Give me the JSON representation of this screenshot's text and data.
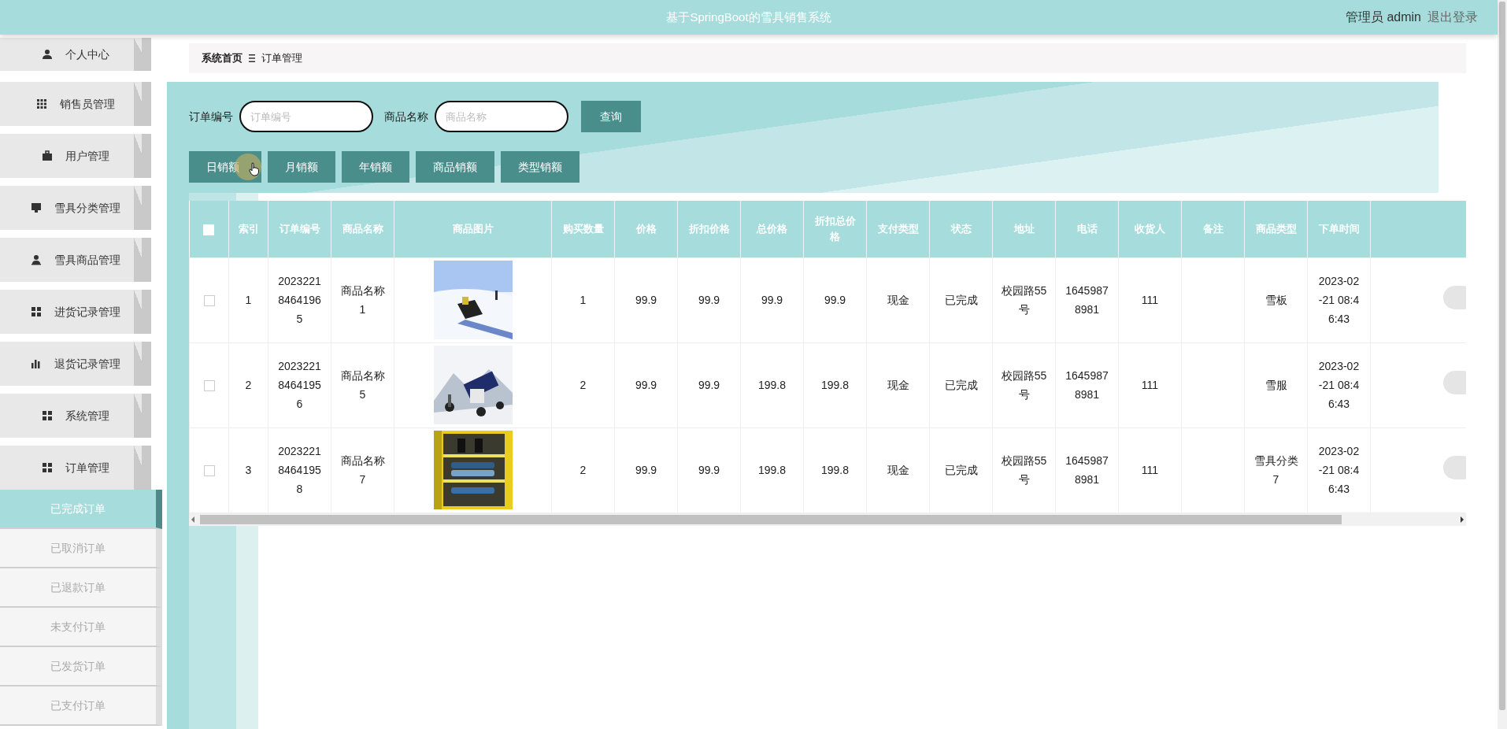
{
  "header": {
    "title": "基于SpringBoot的雪具销售系统",
    "user_role": "管理员",
    "user_name": "admin",
    "logout": "退出登录"
  },
  "sidebar": {
    "items": [
      {
        "label": "个人中心",
        "expanded": false
      },
      {
        "label": "销售员管理",
        "expanded": false
      },
      {
        "label": "用户管理",
        "expanded": false
      },
      {
        "label": "雪具分类管理",
        "expanded": false
      },
      {
        "label": "雪具商品管理",
        "expanded": false
      },
      {
        "label": "进货记录管理",
        "expanded": false
      },
      {
        "label": "退货记录管理",
        "expanded": false
      },
      {
        "label": "系统管理",
        "expanded": false
      },
      {
        "label": "订单管理",
        "expanded": true,
        "children": [
          {
            "label": "已完成订单",
            "selected": true
          },
          {
            "label": "已取消订单",
            "selected": false
          },
          {
            "label": "已退款订单",
            "selected": false
          },
          {
            "label": "未支付订单",
            "selected": false
          },
          {
            "label": "已发货订单",
            "selected": false
          },
          {
            "label": "已支付订单",
            "selected": false
          }
        ]
      }
    ]
  },
  "breadcrumb": [
    "系统首页",
    "订单管理"
  ],
  "search": {
    "fields": [
      {
        "label": "订单编号",
        "placeholder": "订单编号"
      },
      {
        "label": "商品名称",
        "placeholder": "商品名称"
      }
    ],
    "button": "查询"
  },
  "report_buttons": [
    "日销额",
    "月销额",
    "年销额",
    "商品销额",
    "类型销额"
  ],
  "table": {
    "select_all": {
      "checked": false
    },
    "columns": [
      {
        "label": "索引",
        "kind": "text"
      },
      {
        "label": "订单编号",
        "kind": "text"
      },
      {
        "label": "商品名称",
        "kind": "text"
      },
      {
        "label": "商品图片",
        "kind": "picture"
      },
      {
        "label": "购买数量",
        "kind": "text"
      },
      {
        "label": "价格",
        "kind": "text"
      },
      {
        "label": "折扣价格",
        "kind": "text"
      },
      {
        "label": "总价格",
        "kind": "text"
      },
      {
        "label": "折扣总价格",
        "kind": "text"
      },
      {
        "label": "支付类型",
        "kind": "text"
      },
      {
        "label": "状态",
        "kind": "text"
      },
      {
        "label": "地址",
        "kind": "text"
      },
      {
        "label": "电话",
        "kind": "text"
      },
      {
        "label": "收货人",
        "kind": "text"
      },
      {
        "label": "备注",
        "kind": "text"
      },
      {
        "label": "商品类型",
        "kind": "text"
      },
      {
        "label": "下单时间",
        "kind": "text"
      }
    ],
    "rows": [
      {
        "checked": false,
        "cells": [
          "1",
          "202322184641965",
          "商品名称1",
          null,
          "1",
          "99.9",
          "99.9",
          "99.9",
          "99.9",
          "现金",
          "已完成",
          "校园路55号",
          "16459878981",
          "111",
          null,
          "雪板",
          "2023-02-21 08:46:43"
        ]
      },
      {
        "checked": false,
        "cells": [
          "2",
          "202322184641956",
          "商品名称5",
          null,
          "2",
          "99.9",
          "99.9",
          "199.8",
          "199.8",
          "现金",
          "已完成",
          "校园路55号",
          "16459878981",
          "111",
          null,
          "雪服",
          "2023-02-21 08:46:43"
        ]
      },
      {
        "checked": false,
        "cells": [
          "3",
          "202322184641958",
          "商品名称7",
          null,
          "2",
          "99.9",
          "99.9",
          "199.8",
          "199.8",
          "现金",
          "已完成",
          "校园路55号",
          "16459878981",
          "111",
          null,
          "雪具分类7",
          "2023-02-21 08:46:43"
        ]
      }
    ]
  }
}
